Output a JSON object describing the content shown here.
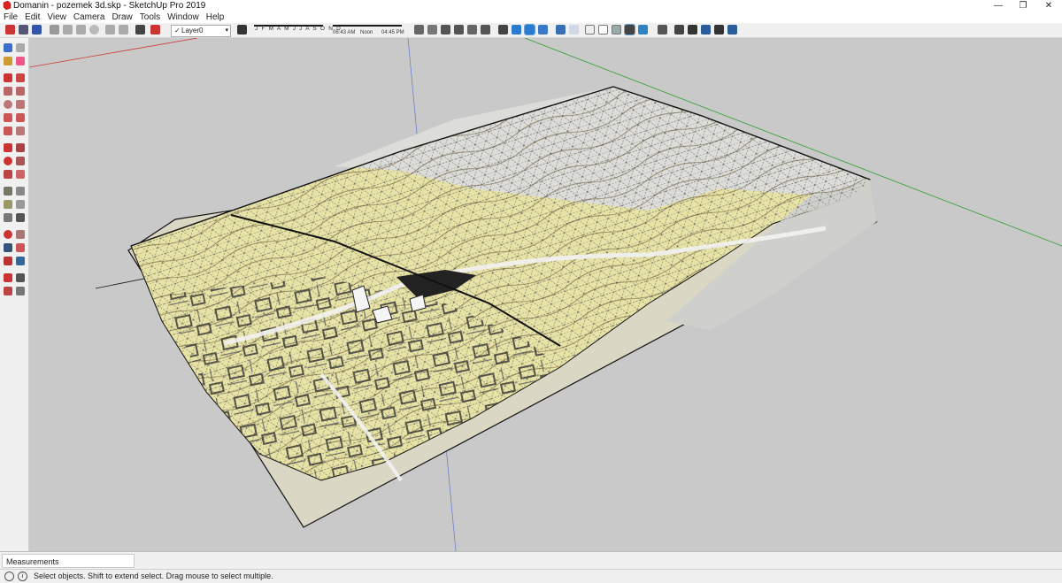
{
  "window": {
    "title": "Domanin - pozemek 3d.skp - SketchUp Pro 2019",
    "minimize": "—",
    "restore": "❐",
    "close": "✕"
  },
  "menu": [
    "File",
    "Edit",
    "View",
    "Camera",
    "Draw",
    "Tools",
    "Window",
    "Help"
  ],
  "layer": {
    "check": "✓",
    "name": "Layer0",
    "caret": "▾"
  },
  "shadow": {
    "months": "J F M A M J J A S O N D",
    "time_start": "06:43 AM",
    "time_mid": "Noon",
    "time_end": "04:45 PM"
  },
  "measurements_label": "Measurements",
  "status": {
    "hint": "Select objects. Shift to extend select. Drag mouse to select multiple."
  },
  "colors": {
    "background": "#c9c9c9",
    "terrain_yellow": "#e7e2a6",
    "terrain_gray": "#d9d9d9",
    "axis_red": "#cc3333",
    "axis_green": "#2f9e2f",
    "axis_blue": "#6f7fc8"
  },
  "icons": [
    "select-icon",
    "component-icon",
    "paint-bucket-icon",
    "eraser-icon",
    "line-icon",
    "freehand-icon",
    "rectangle-icon",
    "rotated-rectangle-icon",
    "circle-icon",
    "polygon-icon",
    "arc-icon",
    "pie-icon",
    "move-icon",
    "push-pull-icon",
    "rotate-icon",
    "follow-me-icon",
    "scale-icon",
    "offset-icon",
    "tape-measure-icon",
    "dimension-icon",
    "protractor-icon",
    "text-icon",
    "axes-icon",
    "3d-text-icon",
    "orbit-icon",
    "pan-icon",
    "zoom-icon",
    "zoom-window-icon",
    "zoom-extents-icon",
    "previous-view-icon",
    "position-camera-icon",
    "walk-icon",
    "look-around-icon",
    "section-plane-icon"
  ]
}
